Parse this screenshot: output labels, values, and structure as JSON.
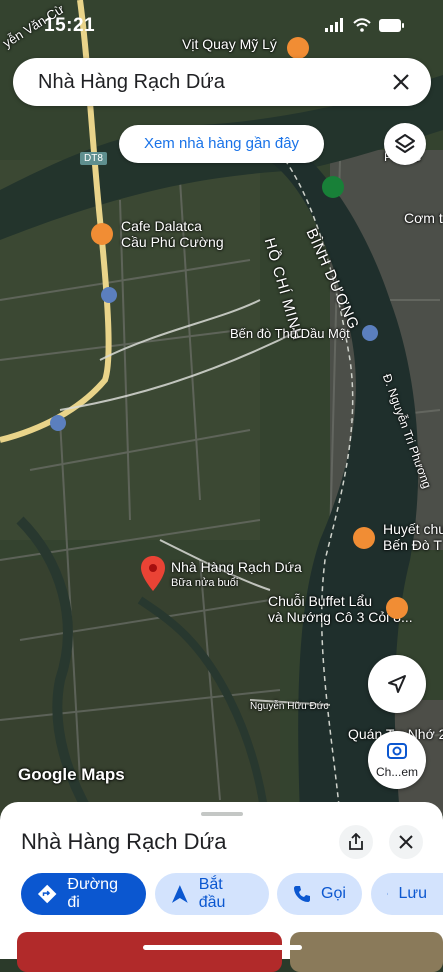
{
  "status": {
    "time": "15:21"
  },
  "search": {
    "query": "Nhà Hàng Rạch Dứa"
  },
  "nearby_chip": "Xem nhà hàng gần đây",
  "map_labels": {
    "vit_quay": "Vịt Quay Mỹ Lý",
    "cafe_line1": "Cafe Dalatca",
    "cafe_line2": "Cầu Phú Cường",
    "river_hcm": "HỒ CHÍ MINH",
    "river_bd": "BÌNH DƯƠNG",
    "ferry": "Bến đò Thủ Dầu Một",
    "street_ntp": "Đ. Nguyễn Tri Phương",
    "huyet_line1": "Huyết chư",
    "huyet_line2": "Bến Đò T",
    "selected_name": "Nhà Hàng Rạch Dứa",
    "selected_sub": "Bữa nửa buổi",
    "buffet_line1": "Chuỗi Buffet Lẩu",
    "buffet_line2": "và Nướng Cô 3 Cỏi 8...",
    "street_nhd": "Nguyễn Hữu Đức",
    "quan": "Quán Tư Nhớ 2",
    "com": "Cơm t",
    "phu": "PHÚ C",
    "route": "DT8",
    "partial_left": "yễn Văn Cừ",
    "google_maps": "Google Maps",
    "camera_label": "Ch...em"
  },
  "sheet": {
    "title": "Nhà Hàng Rạch Dứa",
    "actions": {
      "directions": "Đường đi",
      "start": "Bắt đầu",
      "call": "Gọi",
      "save": "Lưu"
    }
  },
  "colors": {
    "accent": "#0b57d0",
    "pin": "#ea4335",
    "food_poi": "#f18d34"
  }
}
